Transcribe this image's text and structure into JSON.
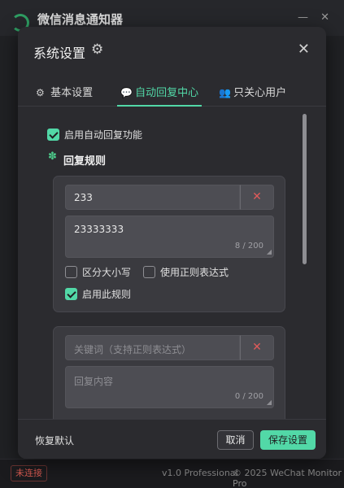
{
  "app": {
    "title": "微信消息通知器",
    "min_glyph": "—",
    "close_glyph": "✕",
    "status": "未连接",
    "version": "v1.0 Professional",
    "copyright": "© 2025 WeChat Monitor Pro"
  },
  "dialog": {
    "title": "系统设置",
    "settings_icon": "⚙",
    "close_icon": "✕",
    "tabs": [
      {
        "label": "基本设置",
        "icon": "⚙",
        "icon_name": "gear-icon",
        "active": false
      },
      {
        "label": "自动回复中心",
        "icon": "💬",
        "icon_name": "chat-icon",
        "active": true
      },
      {
        "label": "只关心用户",
        "icon": "👥",
        "icon_name": "users-icon",
        "active": false
      }
    ],
    "auto_reply": {
      "enable_label": "启用自动回复功能",
      "enabled": true,
      "rules_icon": "✽",
      "rules_title": "回复规则",
      "rules": [
        {
          "keyword": "233",
          "keyword_placeholder": "关键词（支持正则表达式）",
          "delete_icon": "✕",
          "reply": "23333333",
          "reply_placeholder": "回复内容",
          "count": "8 / 200",
          "case_label": "区分大小写",
          "case_sensitive": false,
          "regex_label": "使用正则表达式",
          "use_regex": false,
          "enable_label": "启用此规则",
          "enabled": true
        },
        {
          "keyword": "",
          "keyword_placeholder": "关键词（支持正则表达式）",
          "delete_icon": "✕",
          "reply": "",
          "reply_placeholder": "回复内容",
          "count": "0 / 200"
        }
      ]
    },
    "footer": {
      "restore": "恢复默认",
      "cancel": "取消",
      "save": "保存设置"
    }
  },
  "colors": {
    "accent": "#52d8a7",
    "danger": "#e05a5a",
    "dialog_bg": "#2b2b2f",
    "card_bg": "#3a3a3f"
  }
}
